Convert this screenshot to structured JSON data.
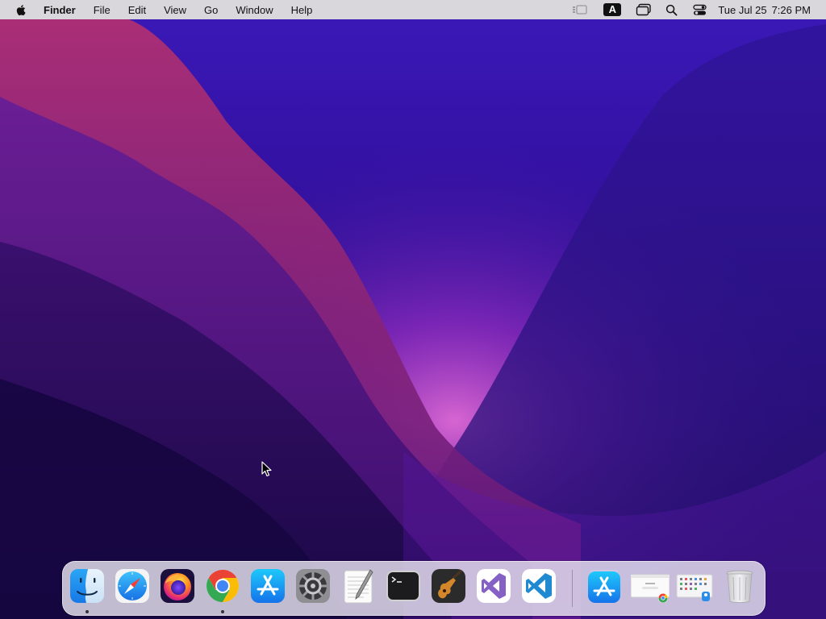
{
  "menubar": {
    "app_name": "Finder",
    "menus": [
      "File",
      "Edit",
      "View",
      "Go",
      "Window",
      "Help"
    ],
    "input_source": "A",
    "clock": {
      "day": "Tue Jul 25",
      "time": "7:26 PM"
    }
  },
  "dock": {
    "apps": [
      {
        "name": "Finder",
        "icon": "finder-icon",
        "running": true
      },
      {
        "name": "Safari",
        "icon": "safari-icon",
        "running": false
      },
      {
        "name": "Firefox",
        "icon": "firefox-icon",
        "running": false
      },
      {
        "name": "Google Chrome",
        "icon": "chrome-icon",
        "running": true
      },
      {
        "name": "App Store",
        "icon": "app-store-icon",
        "running": false
      },
      {
        "name": "System Settings",
        "icon": "system-settings-icon",
        "running": false
      },
      {
        "name": "TextEdit",
        "icon": "textedit-icon",
        "running": false
      },
      {
        "name": "Terminal",
        "icon": "terminal-icon",
        "running": false
      },
      {
        "name": "GarageBand",
        "icon": "garageband-icon",
        "running": false
      },
      {
        "name": "Visual Studio",
        "icon": "visual-studio-icon",
        "running": false
      },
      {
        "name": "Visual Studio Code",
        "icon": "vscode-icon",
        "running": false
      }
    ],
    "extras": [
      {
        "name": "App Store Downloads",
        "icon": "app-store-folder-icon"
      },
      {
        "name": "Chrome Window",
        "icon": "chrome-window-thumbnail-icon"
      },
      {
        "name": "Launchpad Folder",
        "icon": "apps-folder-icon"
      },
      {
        "name": "Trash",
        "icon": "trash-icon"
      }
    ]
  },
  "colors": {
    "menubar": "#d9d7db",
    "wallpaper_top": "#3a19b8",
    "wallpaper_glow": "#c04bd0",
    "dock": "#e8e4f0"
  }
}
